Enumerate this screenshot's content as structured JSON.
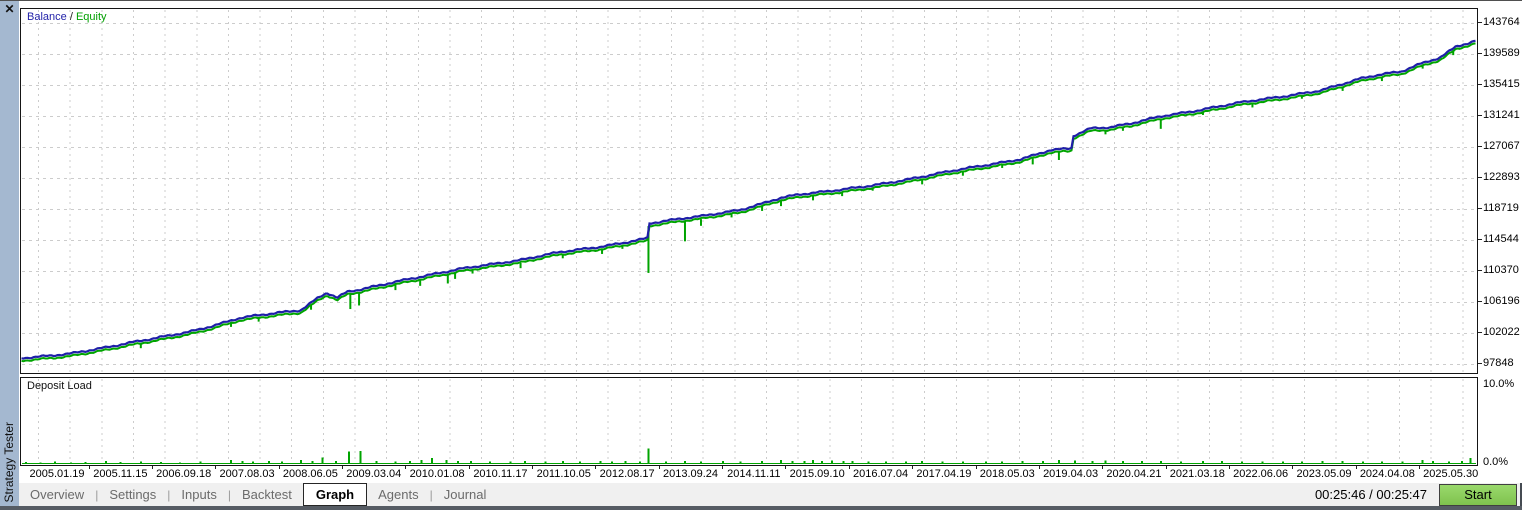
{
  "window": {
    "close_icon": "✕",
    "sidebar_title": "Strategy Tester"
  },
  "ui": {
    "tab_separator": "|"
  },
  "tabs": [
    {
      "label": "Overview",
      "active": false
    },
    {
      "label": "Settings",
      "active": false
    },
    {
      "label": "Inputs",
      "active": false
    },
    {
      "label": "Backtest",
      "active": false
    },
    {
      "label": "Graph",
      "active": true
    },
    {
      "label": "Agents",
      "active": false
    },
    {
      "label": "Journal",
      "active": false
    }
  ],
  "statusbar": {
    "elapsed_time": "00:25:46 / 00:25:47",
    "start_button": "Start"
  },
  "chart_data": [
    {
      "type": "line",
      "title": "Balance / Equity",
      "legend": {
        "balance_label": "Balance",
        "separator": " / ",
        "equity_label": "Equity"
      },
      "grid": "dashed",
      "legend_position": "top-left",
      "ylim": [
        96750,
        145600
      ],
      "y_ticks": [
        143764,
        139589,
        135415,
        131241,
        127067,
        122893,
        118719,
        114544,
        110370,
        106196,
        102022,
        97848
      ],
      "x_tick_labels": [
        "2005.01.19",
        "2005.11.15",
        "2006.09.18",
        "2007.08.03",
        "2008.06.05",
        "2009.03.04",
        "2010.01.08",
        "2010.11.17",
        "2011.10.05",
        "2012.08.17",
        "2013.09.24",
        "2014.11.11",
        "2015.09.10",
        "2016.07.04",
        "2017.04.19",
        "2018.05.03",
        "2019.04.03",
        "2020.04.21",
        "2021.03.18",
        "2022.06.06",
        "2023.05.09",
        "2024.04.08",
        "2025.05.30"
      ],
      "series": [
        {
          "name": "Balance",
          "color": "#1f1fa8",
          "points": [
            [
              0,
              98690
            ],
            [
              0.034,
              99360
            ],
            [
              0.061,
              100170
            ],
            [
              0.089,
              101240
            ],
            [
              0.116,
              102320
            ],
            [
              0.13,
              102990
            ],
            [
              0.15,
              104060
            ],
            [
              0.171,
              104600
            ],
            [
              0.192,
              105130
            ],
            [
              0.204,
              106880
            ],
            [
              0.21,
              107550
            ],
            [
              0.217,
              106880
            ],
            [
              0.224,
              107680
            ],
            [
              0.233,
              107950
            ],
            [
              0.247,
              108490
            ],
            [
              0.274,
              109560
            ],
            [
              0.302,
              110770
            ],
            [
              0.315,
              111170
            ],
            [
              0.343,
              111840
            ],
            [
              0.37,
              112910
            ],
            [
              0.398,
              113720
            ],
            [
              0.429,
              114790
            ],
            [
              0.4302,
              114790
            ],
            [
              0.4309,
              116800
            ],
            [
              0.467,
              117740
            ],
            [
              0.494,
              118680
            ],
            [
              0.522,
              120290
            ],
            [
              0.535,
              120690
            ],
            [
              0.556,
              121100
            ],
            [
              0.583,
              121900
            ],
            [
              0.611,
              122840
            ],
            [
              0.638,
              123780
            ],
            [
              0.666,
              124720
            ],
            [
              0.687,
              125520
            ],
            [
              0.707,
              126730
            ],
            [
              0.7216,
              126900
            ],
            [
              0.723,
              128600
            ],
            [
              0.735,
              129550
            ],
            [
              0.748,
              129680
            ],
            [
              0.762,
              130220
            ],
            [
              0.783,
              131290
            ],
            [
              0.81,
              132090
            ],
            [
              0.838,
              133030
            ],
            [
              0.865,
              133840
            ],
            [
              0.893,
              134780
            ],
            [
              0.92,
              136250
            ],
            [
              0.934,
              136790
            ],
            [
              0.948,
              137190
            ],
            [
              0.961,
              138260
            ],
            [
              0.975,
              139200
            ],
            [
              0.986,
              140680
            ],
            [
              0.996,
              141220
            ],
            [
              1,
              141480
            ]
          ]
        },
        {
          "name": "Equity",
          "color": "#00a400",
          "derived_from": "Balance",
          "offset_value": -350,
          "spikes": [
            [
              0.082,
              600
            ],
            [
              0.144,
              500
            ],
            [
              0.163,
              450
            ],
            [
              0.199,
              600
            ],
            [
              0.226,
              2100
            ],
            [
              0.232,
              1800
            ],
            [
              0.257,
              700
            ],
            [
              0.274,
              800
            ],
            [
              0.293,
              1300
            ],
            [
              0.298,
              900
            ],
            [
              0.31,
              600
            ],
            [
              0.343,
              700
            ],
            [
              0.372,
              500
            ],
            [
              0.399,
              700
            ],
            [
              0.413,
              500
            ],
            [
              0.4309,
              6300
            ],
            [
              0.456,
              2700
            ],
            [
              0.467,
              900
            ],
            [
              0.488,
              500
            ],
            [
              0.509,
              700
            ],
            [
              0.522,
              800
            ],
            [
              0.544,
              600
            ],
            [
              0.564,
              500
            ],
            [
              0.585,
              400
            ],
            [
              0.619,
              700
            ],
            [
              0.647,
              500
            ],
            [
              0.674,
              400
            ],
            [
              0.695,
              900
            ],
            [
              0.713,
              1100
            ],
            [
              0.745,
              500
            ],
            [
              0.757,
              400
            ],
            [
              0.783,
              1400
            ],
            [
              0.812,
              400
            ],
            [
              0.846,
              500
            ],
            [
              0.88,
              400
            ],
            [
              0.908,
              600
            ],
            [
              0.935,
              500
            ],
            [
              0.963,
              400
            ],
            [
              0.984,
              600
            ]
          ]
        }
      ]
    },
    {
      "type": "bar",
      "title": "Deposit Load",
      "color": "#00a400",
      "ylim": [
        0,
        10
      ],
      "y_tick_labels": [
        "10.0%",
        "0.0%"
      ],
      "baseline_pct": 0.15,
      "bars": [
        [
          0.003,
          0.25
        ],
        [
          0.013,
          0.2
        ],
        [
          0.023,
          0.3
        ],
        [
          0.034,
          0.2
        ],
        [
          0.044,
          0.25
        ],
        [
          0.058,
          0.4
        ],
        [
          0.068,
          0.25
        ],
        [
          0.082,
          0.3
        ],
        [
          0.096,
          0.25
        ],
        [
          0.109,
          0.2
        ],
        [
          0.123,
          0.3
        ],
        [
          0.144,
          0.5
        ],
        [
          0.152,
          0.4
        ],
        [
          0.159,
          0.3
        ],
        [
          0.17,
          0.35
        ],
        [
          0.179,
          0.3
        ],
        [
          0.192,
          0.5
        ],
        [
          0.2,
          0.4
        ],
        [
          0.207,
          0.8
        ],
        [
          0.216,
          0.4
        ],
        [
          0.225,
          1.45
        ],
        [
          0.233,
          1.55
        ],
        [
          0.244,
          0.35
        ],
        [
          0.257,
          0.3
        ],
        [
          0.267,
          0.35
        ],
        [
          0.275,
          0.5
        ],
        [
          0.282,
          0.7
        ],
        [
          0.292,
          0.5
        ],
        [
          0.3,
          0.35
        ],
        [
          0.309,
          0.4
        ],
        [
          0.322,
          0.3
        ],
        [
          0.336,
          0.3
        ],
        [
          0.346,
          0.35
        ],
        [
          0.36,
          0.3
        ],
        [
          0.372,
          0.4
        ],
        [
          0.384,
          0.3
        ],
        [
          0.398,
          0.35
        ],
        [
          0.406,
          0.3
        ],
        [
          0.415,
          0.4
        ],
        [
          0.425,
          0.3
        ],
        [
          0.431,
          1.8
        ],
        [
          0.443,
          0.3
        ],
        [
          0.456,
          0.35
        ],
        [
          0.467,
          0.3
        ],
        [
          0.482,
          0.4
        ],
        [
          0.494,
          0.3
        ],
        [
          0.509,
          0.35
        ],
        [
          0.522,
          0.5
        ],
        [
          0.53,
          0.4
        ],
        [
          0.538,
          0.4
        ],
        [
          0.544,
          0.5
        ],
        [
          0.55,
          0.4
        ],
        [
          0.557,
          0.45
        ],
        [
          0.565,
          0.4
        ],
        [
          0.571,
          0.35
        ],
        [
          0.582,
          0.3
        ],
        [
          0.594,
          0.3
        ],
        [
          0.608,
          0.3
        ],
        [
          0.619,
          0.35
        ],
        [
          0.633,
          0.3
        ],
        [
          0.647,
          0.3
        ],
        [
          0.663,
          0.3
        ],
        [
          0.674,
          0.3
        ],
        [
          0.688,
          0.35
        ],
        [
          0.702,
          0.4
        ],
        [
          0.713,
          0.5
        ],
        [
          0.724,
          0.45
        ],
        [
          0.736,
          0.4
        ],
        [
          0.745,
          0.45
        ],
        [
          0.757,
          0.35
        ],
        [
          0.77,
          0.4
        ],
        [
          0.783,
          0.35
        ],
        [
          0.797,
          0.3
        ],
        [
          0.812,
          0.35
        ],
        [
          0.825,
          0.4
        ],
        [
          0.839,
          0.3
        ],
        [
          0.853,
          0.3
        ],
        [
          0.867,
          0.3
        ],
        [
          0.88,
          0.3
        ],
        [
          0.894,
          0.35
        ],
        [
          0.908,
          0.4
        ],
        [
          0.922,
          0.3
        ],
        [
          0.935,
          0.3
        ],
        [
          0.949,
          0.3
        ],
        [
          0.963,
          0.5
        ],
        [
          0.97,
          0.4
        ],
        [
          0.981,
          0.3
        ],
        [
          0.99,
          0.35
        ],
        [
          0.996,
          0.75
        ]
      ]
    }
  ]
}
